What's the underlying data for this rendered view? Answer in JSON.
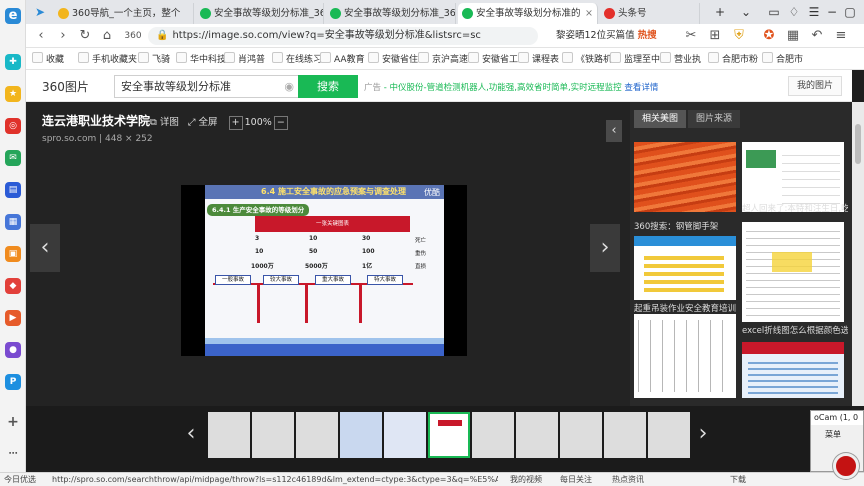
{
  "browser": {
    "tabs": [
      {
        "label": "360导航_一个主页，整个",
        "active": false
      },
      {
        "label": "安全事故等级划分标准_360",
        "active": false
      },
      {
        "label": "安全事故等级划分标准_360",
        "active": false
      },
      {
        "label": "安全事故等级划分标准的",
        "active": true
      },
      {
        "label": "头条号",
        "active": false
      }
    ],
    "address": "https://image.so.com/view?q=安全事故等级划分标准&listsrc=sc",
    "address_search": "黎姿晒12位买篇值",
    "hot_label": "热搜",
    "bookmarks": [
      "收藏",
      "手机收藏夹",
      "飞骑",
      "华中科技",
      "肖鸿普",
      "在线练习",
      "AA教育",
      "安徽省住",
      "京沪高速",
      "安徽省工",
      "课程表",
      "《铁路机",
      "监理至中",
      "营业执",
      "合肥市粉",
      "合肥市"
    ]
  },
  "image_search": {
    "logo_text": "360图片",
    "query": "安全事故等级划分标准",
    "search_button": "搜索",
    "ad_tag": "广告",
    "ad_text": "中仪股份-管道检测机器人,功能强,高效省时简单,实时远程监控",
    "ad_link": "查看详情",
    "my_images": "我的图片"
  },
  "viewer": {
    "title": "连云港职业技术学院",
    "detail_label": "详图",
    "fullscreen_label": "全屏",
    "zoom": "100%",
    "source": "spro.so.com",
    "size": "448 × 252",
    "slide": {
      "header": "6.4 施工安全事故的应急预案与调查处理",
      "watermark": "优酷",
      "section": "6.4.1 生产安全事故的等级划分",
      "red_box": "一张关键图表",
      "rows": [
        {
          "c1": "3",
          "c2": "10",
          "c3": "30",
          "tag": "死亡"
        },
        {
          "c1": "10",
          "c2": "50",
          "c3": "100",
          "tag": "重伤"
        },
        {
          "c1": "1000万",
          "c2": "5000万",
          "c3": "1亿",
          "tag": "直损"
        }
      ],
      "levels": [
        "一般事故",
        "较大事故",
        "重大事故",
        "特大事故"
      ]
    }
  },
  "right_panel": {
    "tabs": [
      "相关美图",
      "图片来源"
    ],
    "captions": [
      "360搜索：钢管脚手架",
      "超人回来了:本特和注生日,吃...",
      "起重吊装作业安全教育培训",
      "excel折线图怎么根据颜色选..."
    ]
  },
  "filmstrip": {
    "count": 11,
    "selected_index": 5
  },
  "status": {
    "left_label": "今日优选",
    "url": "http://spro.so.com/searchthrow/api/midpage/throw?ls=s112c46189d&lm_extend=ctype:3&ctype=3&q=%E5%AE%89%",
    "my_video": "我的视频",
    "daily": "每日关注",
    "hot_news": "热点资讯",
    "download": "下载"
  },
  "ocam": {
    "title": "oCam (1, 0",
    "menu": "菜单"
  },
  "colors": {
    "accent": "#19b955",
    "slide_red": "#c8182a",
    "slide_blue": "#3b63c9"
  }
}
